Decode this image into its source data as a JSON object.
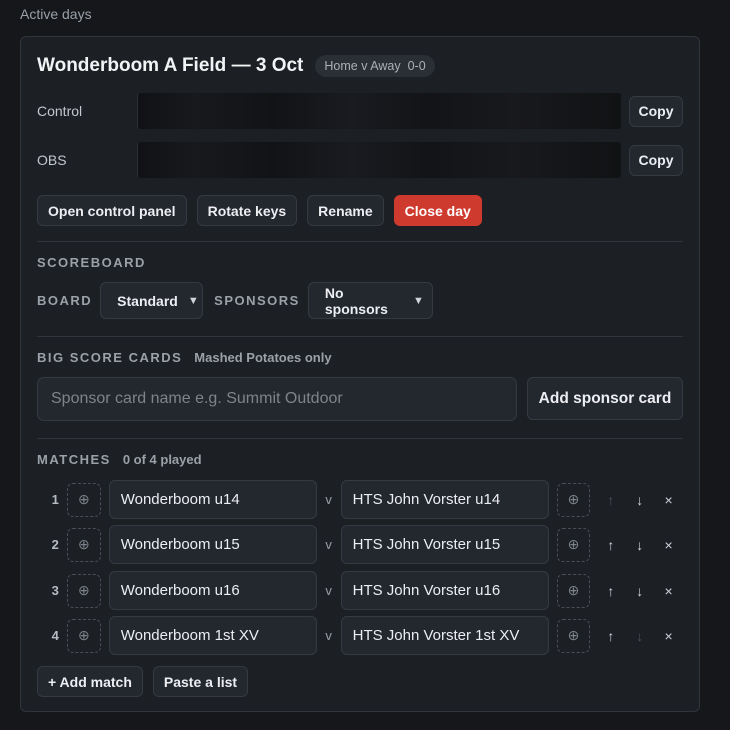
{
  "section_label": "Active days",
  "day": {
    "title": "Wonderboom A Field — 3 Oct",
    "badge_teams": "Home v Away",
    "badge_score": "0-0",
    "control_label": "Control",
    "obs_label": "OBS",
    "copy_label": "Copy",
    "actions": {
      "open_control_panel": "Open control panel",
      "rotate_keys": "Rotate keys",
      "rename": "Rename",
      "close_day": "Close day"
    }
  },
  "scoreboard": {
    "heading": "SCOREBOARD",
    "board_label": "BOARD",
    "board_value": "Standard",
    "sponsors_label": "SPONSORS",
    "sponsors_value": "No sponsors"
  },
  "big_score_cards": {
    "heading": "BIG SCORE CARDS",
    "note": "Mashed Potatoes only",
    "input_placeholder": "Sponsor card name e.g. Summit Outdoor",
    "input_value": "",
    "add_label": "Add sponsor card"
  },
  "matches": {
    "heading": "MATCHES",
    "played": "0 of 4 played",
    "vs": "v",
    "rows": [
      {
        "num": "1",
        "home": "Wonderboom u14",
        "away": "HTS John Vorster u14"
      },
      {
        "num": "2",
        "home": "Wonderboom u15",
        "away": "HTS John Vorster u15"
      },
      {
        "num": "3",
        "home": "Wonderboom u16",
        "away": "HTS John Vorster u16"
      },
      {
        "num": "4",
        "home": "Wonderboom 1st XV",
        "away": "HTS John Vorster 1st XV"
      }
    ],
    "add_match": "+ Add match",
    "paste_list": "Paste a list"
  },
  "icons": {
    "logo": "⊕",
    "up": "↑",
    "down": "↓",
    "remove": "×"
  }
}
